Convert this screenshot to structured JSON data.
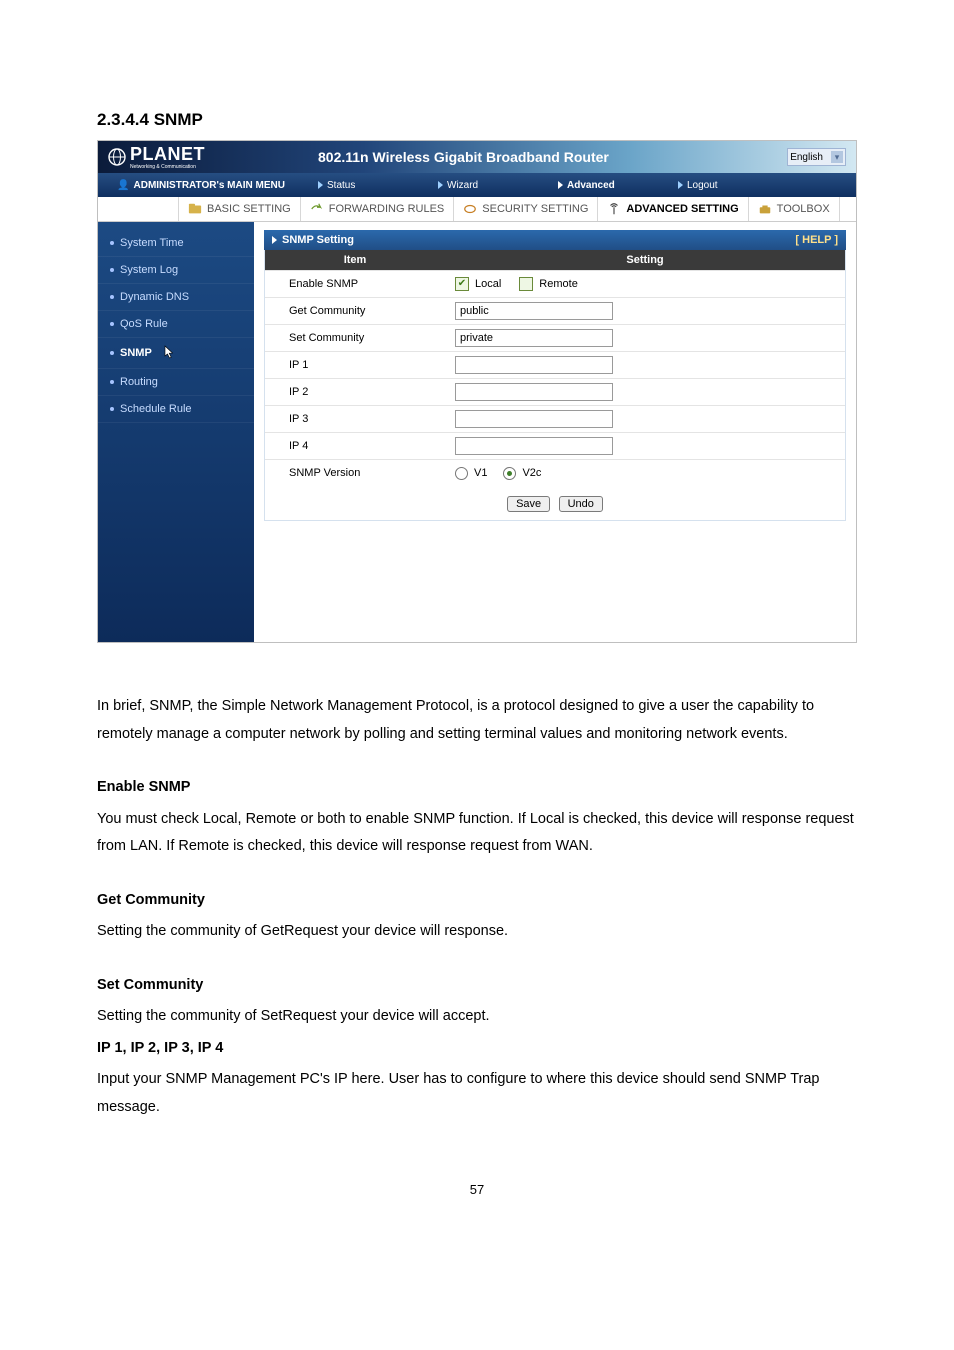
{
  "heading": "2.3.4.4 SNMP",
  "banner": {
    "brand": "PLANET",
    "brand_sub": "Networking & Communication",
    "title": "802.11n Wireless Gigabit Broadband Router",
    "language": "English"
  },
  "mainnav": {
    "admin_label": "ADMINISTRATOR's MAIN MENU",
    "items": [
      {
        "label": "Status"
      },
      {
        "label": "Wizard"
      },
      {
        "label": "Advanced",
        "active": true
      },
      {
        "label": "Logout"
      }
    ]
  },
  "subnav": [
    {
      "label": "BASIC SETTING"
    },
    {
      "label": "FORWARDING RULES"
    },
    {
      "label": "SECURITY SETTING"
    },
    {
      "label": "ADVANCED SETTING",
      "active": true
    },
    {
      "label": "TOOLBOX"
    }
  ],
  "sidebar": [
    {
      "label": "System Time"
    },
    {
      "label": "System Log"
    },
    {
      "label": "Dynamic DNS"
    },
    {
      "label": "QoS Rule"
    },
    {
      "label": "SNMP",
      "active": true,
      "cursor": true
    },
    {
      "label": "Routing"
    },
    {
      "label": "Schedule Rule"
    }
  ],
  "panel": {
    "title": "SNMP Setting",
    "help": "[ HELP ]",
    "col_item": "Item",
    "col_setting": "Setting",
    "rows": {
      "enable_label": "Enable SNMP",
      "enable_local": "Local",
      "enable_remote": "Remote",
      "get_label": "Get Community",
      "get_value": "public",
      "set_label": "Set Community",
      "set_value": "private",
      "ip1_label": "IP 1",
      "ip1_value": "",
      "ip2_label": "IP 2",
      "ip2_value": "",
      "ip3_label": "IP 3",
      "ip3_value": "",
      "ip4_label": "IP 4",
      "ip4_value": "",
      "ver_label": "SNMP Version",
      "ver_v1": "V1",
      "ver_v2c": "V2c"
    },
    "save_btn": "Save",
    "undo_btn": "Undo"
  },
  "doc": {
    "p1": "In brief, SNMP, the Simple Network Management Protocol, is a protocol designed to give a user the capability to remotely manage a computer network by polling and setting terminal values and monitoring network events.",
    "h_enable": "Enable SNMP",
    "p_enable": "You must check Local, Remote or both to enable SNMP function. If Local is checked, this device will response request from LAN. If Remote is checked, this device will response request from WAN.",
    "h_get": "Get Community",
    "p_get": "Setting the community of GetRequest your device will response.",
    "h_set": "Set Community",
    "p_set": "Setting the community of SetRequest your device will accept.",
    "h_ip": "IP 1, IP 2, IP 3, IP 4",
    "p_ip": "Input your SNMP Management PC's IP here. User has to configure to where this device should send SNMP Trap message."
  },
  "page_number": "57"
}
